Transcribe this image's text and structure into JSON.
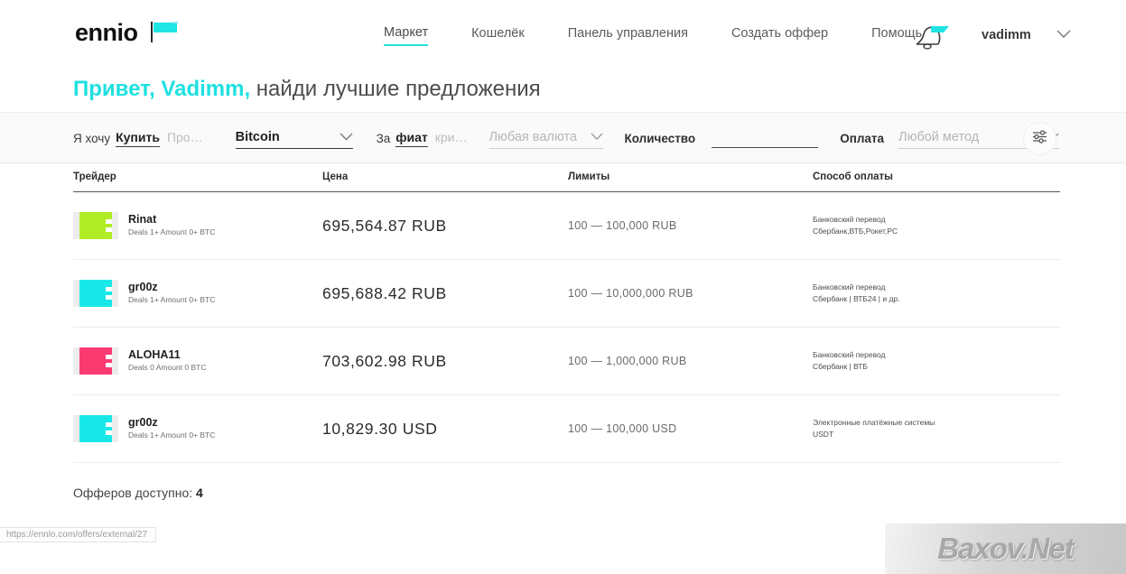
{
  "header": {
    "logo_text": "ennio",
    "logo_icon": "flag-icon",
    "nav": [
      {
        "label": "Маркет",
        "active": true
      },
      {
        "label": "Кошелёк",
        "active": false
      },
      {
        "label": "Панель управления",
        "active": false
      },
      {
        "label": "Создать оффер",
        "active": false
      },
      {
        "label": "Помощь",
        "active": false
      }
    ],
    "bell_icon": "notification-bell-icon",
    "user": "vadimm",
    "user_chevron": "chevron-down-icon",
    "accent_color": "#1fe0e0"
  },
  "greeting": {
    "highlight": "Привет, Vadimm,",
    "rest": " найди лучшие предложения"
  },
  "filters": {
    "intent_label": "Я хочу",
    "intent_selected": "Купить",
    "intent_other": "Про…",
    "crypto_value": "Bitcoin",
    "for_label": "За",
    "fiat_selected": "фиат",
    "fiat_other": "кри…",
    "currency_placeholder": "Любая валюта",
    "amount_label": "Количество",
    "amount_value": "",
    "payment_label": "Оплата",
    "payment_placeholder": "Любой метод",
    "settings_icon": "sliders-filter-icon",
    "chevron_icon": "chevron-down-icon"
  },
  "table": {
    "columns": [
      "Трейдер",
      "Цена",
      "Лимиты",
      "Способ оплаты"
    ],
    "rows": [
      {
        "trader": "Rinat",
        "meta": "Deals 1+ Amount 0+ BTC",
        "avatar_color": "#b0ed25",
        "price": "695,564.87 RUB",
        "limits": "100 — 100,000 RUB",
        "method_title": "Банковский перевод",
        "method_sub": "Сбербанк,ВТБ,Рокет,РС"
      },
      {
        "trader": "gr00z",
        "meta": "Deals 1+ Amount 0+ BTC",
        "avatar_color": "#19e8e8",
        "price": "695,688.42 RUB",
        "limits": "100 — 10,000,000 RUB",
        "method_title": "Банковский перевод",
        "method_sub": "Сбербанк | ВТБ24 | и др."
      },
      {
        "trader": "ALOHA11",
        "meta": "Deals 0 Amount 0 BTC",
        "avatar_color": "#fb3a72",
        "price": "703,602.98 RUB",
        "limits": "100 — 1,000,000 RUB",
        "method_title": "Банковский перевод",
        "method_sub": "Сбербанк | ВТБ"
      },
      {
        "trader": "gr00z",
        "meta": "Deals 1+ Amount 0+ BTC",
        "avatar_color": "#19e8e8",
        "price": "10,829.30 USD",
        "limits": "100 — 100,000 USD",
        "method_title": "Электронные платёжные системы",
        "method_sub": "USDT"
      }
    ]
  },
  "footer": {
    "count_label": "Офферов доступно:",
    "count_value": "4"
  },
  "statusbar": {
    "url": "https://ennlo.com/offers/external/27"
  },
  "watermark": {
    "text": "Baxov.Net"
  }
}
